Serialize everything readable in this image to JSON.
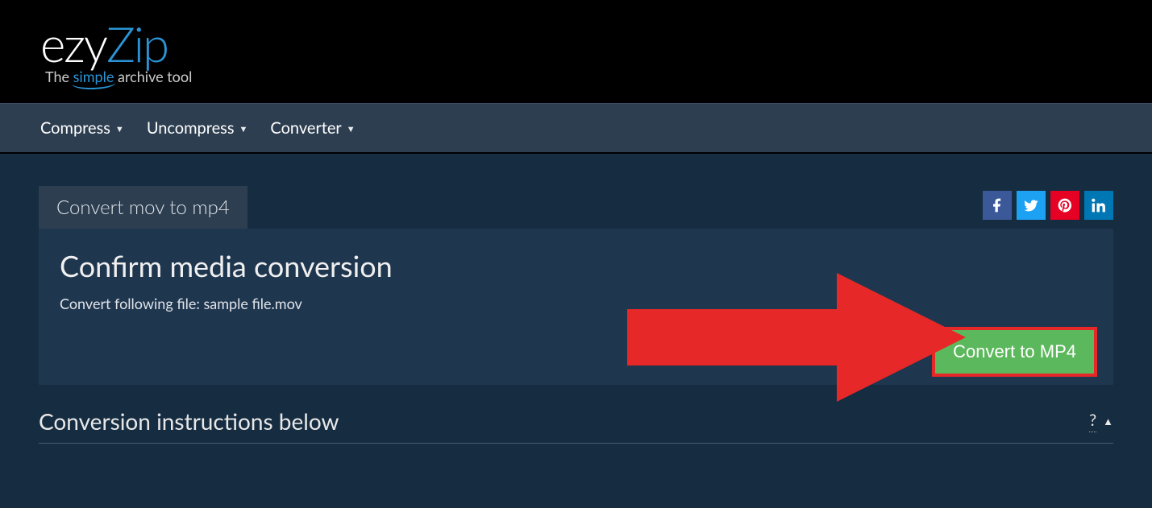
{
  "logo": {
    "part1": "ezy",
    "part2": "Zip"
  },
  "tagline": {
    "pre": "The ",
    "emph": "simple",
    "post": " archive tool"
  },
  "nav": {
    "items": [
      {
        "label": "Compress"
      },
      {
        "label": "Uncompress"
      },
      {
        "label": "Converter"
      }
    ]
  },
  "tab": {
    "label": "Convert mov to mp4"
  },
  "panel": {
    "heading": "Confirm media conversion",
    "subline": "Convert following file: sample file.mov",
    "button": "Convert to MP4"
  },
  "instructions": {
    "title": "Conversion instructions below",
    "toggle": "?"
  }
}
